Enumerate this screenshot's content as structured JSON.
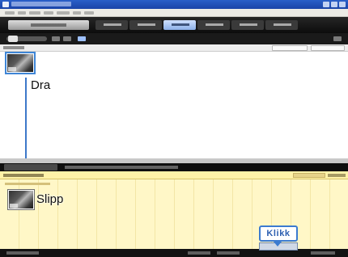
{
  "annotations": {
    "drag_label": "Dra",
    "drop_label": "Slipp",
    "click_label": "Klikk"
  },
  "colors": {
    "accent": "#3d78c9",
    "drop_area": "#fff7c7",
    "dark_chrome": "#0c0c0c"
  },
  "icons": {
    "source_clip": "video-thumbnail-icon",
    "dropped_clip": "video-thumbnail-icon",
    "arrow": "arrow-down-icon"
  }
}
